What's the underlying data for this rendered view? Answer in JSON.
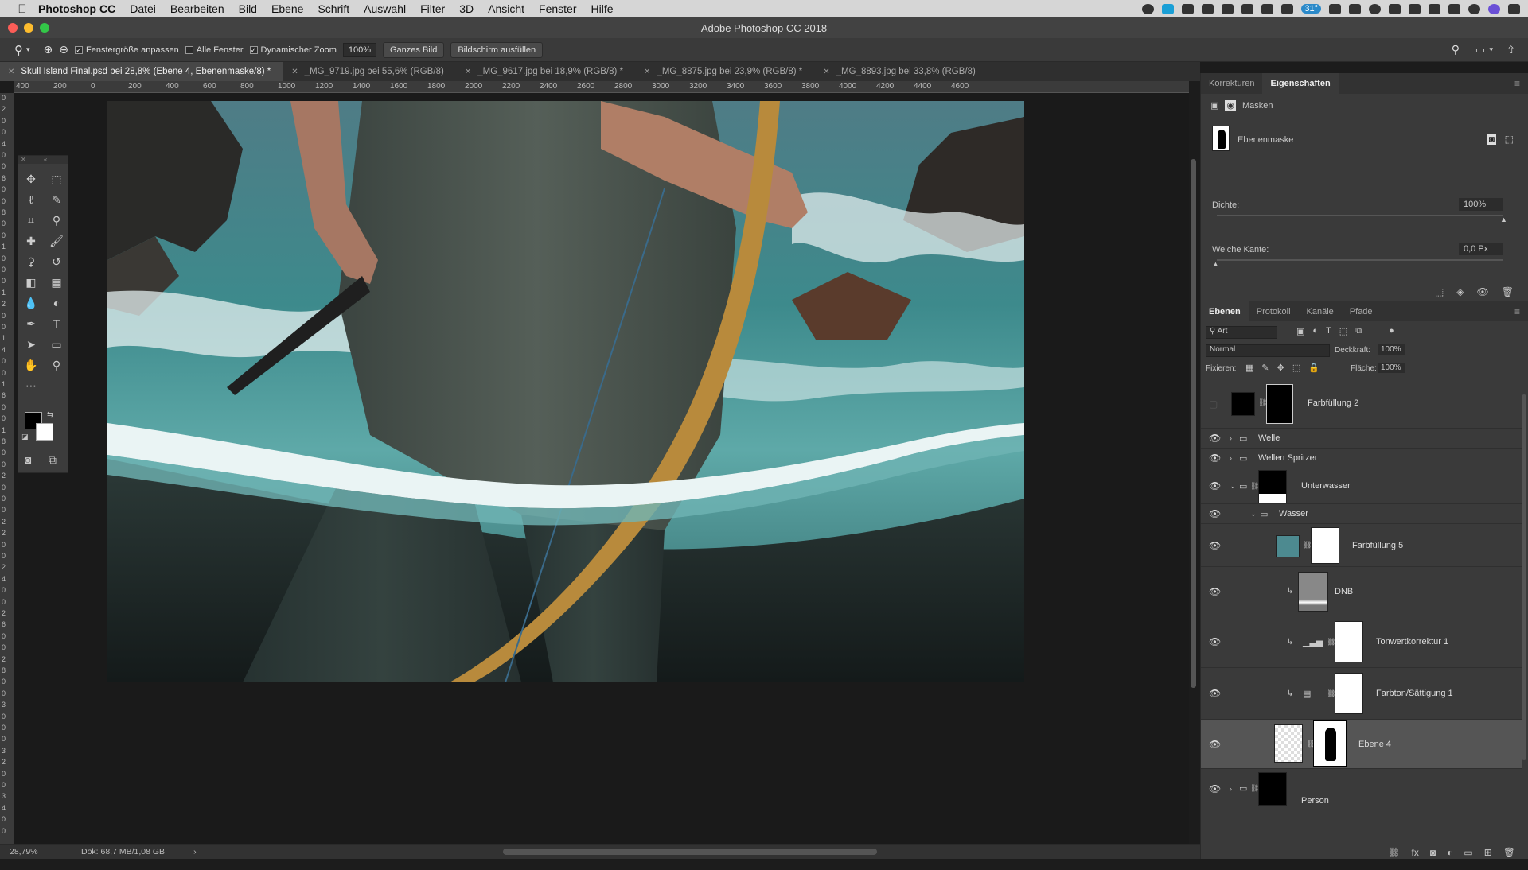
{
  "menubar": {
    "app": "Photoshop CC",
    "items": [
      "Datei",
      "Bearbeiten",
      "Bild",
      "Ebene",
      "Schrift",
      "Auswahl",
      "Filter",
      "3D",
      "Ansicht",
      "Fenster",
      "Hilfe"
    ],
    "battery_badge": "31°"
  },
  "window": {
    "title": "Adobe Photoshop CC 2018"
  },
  "options": {
    "fit_window": "Fenstergröße anpassen",
    "all_windows": "Alle Fenster",
    "dynamic_zoom": "Dynamischer Zoom",
    "zoom_value": "100%",
    "fit_screen": "Ganzes Bild",
    "fill_screen": "Bildschirm ausfüllen"
  },
  "tabs": [
    {
      "label": "Skull Island Final.psd bei 28,8% (Ebene 4, Ebenenmaske/8) *"
    },
    {
      "label": "_MG_9719.jpg bei 55,6% (RGB/8)"
    },
    {
      "label": "_MG_9617.jpg bei 18,9% (RGB/8) *"
    },
    {
      "label": "_MG_8875.jpg bei 23,9% (RGB/8) *"
    },
    {
      "label": "_MG_8893.jpg bei 33,8% (RGB/8)"
    }
  ],
  "ruler_h": [
    "400",
    "200",
    "0",
    "200",
    "400",
    "600",
    "800",
    "1000",
    "1200",
    "1400",
    "1600",
    "1800",
    "2000",
    "2200",
    "2400",
    "2600",
    "2800",
    "3000",
    "3200",
    "3400",
    "3600",
    "3800",
    "4000",
    "4200",
    "4400",
    "4600"
  ],
  "ruler_v": [
    "0",
    "2",
    "0",
    "0",
    "4",
    "0",
    "0",
    "6",
    "0",
    "0",
    "8",
    "0",
    "0",
    "1",
    "0",
    "0",
    "0",
    "1",
    "2",
    "0",
    "0",
    "1",
    "4",
    "0",
    "0",
    "1",
    "6",
    "0",
    "0",
    "1",
    "8",
    "0",
    "0",
    "2",
    "0",
    "0",
    "0",
    "2",
    "2",
    "0",
    "0",
    "2",
    "4",
    "0",
    "0",
    "2",
    "6",
    "0",
    "0",
    "2",
    "8",
    "0",
    "0",
    "3",
    "0",
    "0",
    "0",
    "3",
    "2",
    "0",
    "0",
    "3",
    "4",
    "0",
    "0"
  ],
  "status": {
    "zoom": "28,79%",
    "doc": "Dok: 68,7 MB/1,08 GB"
  },
  "properties": {
    "tabs": [
      "Korrekturen",
      "Eigenschaften"
    ],
    "masks_label": "Masken",
    "layer_mask_label": "Ebenenmaske",
    "density_label": "Dichte:",
    "density_value": "100%",
    "feather_label": "Weiche Kante:",
    "feather_value": "0,0 Px"
  },
  "layers_panel": {
    "tabs": [
      "Ebenen",
      "Protokoll",
      "Kanäle",
      "Pfade"
    ],
    "filter": "Art",
    "blend_mode": "Normal",
    "opacity_label": "Deckkraft:",
    "opacity_value": "100%",
    "lock_label": "Fixieren:",
    "fill_label": "Fläche:",
    "fill_value": "100%",
    "layers": [
      {
        "name": "Farbfüllung 2"
      },
      {
        "name": "Welle"
      },
      {
        "name": "Wellen Spritzer"
      },
      {
        "name": "Unterwasser"
      },
      {
        "name": "Wasser"
      },
      {
        "name": "Farbfüllung 5"
      },
      {
        "name": "DNB"
      },
      {
        "name": "Tonwertkorrektur 1"
      },
      {
        "name": "Farbton/Sättigung 1"
      },
      {
        "name": "Ebene 4"
      },
      {
        "name": "Person"
      }
    ]
  },
  "colors": {
    "accent": "#2a89c9",
    "panel": "#3a3a3a",
    "water": "#3d7d80"
  }
}
